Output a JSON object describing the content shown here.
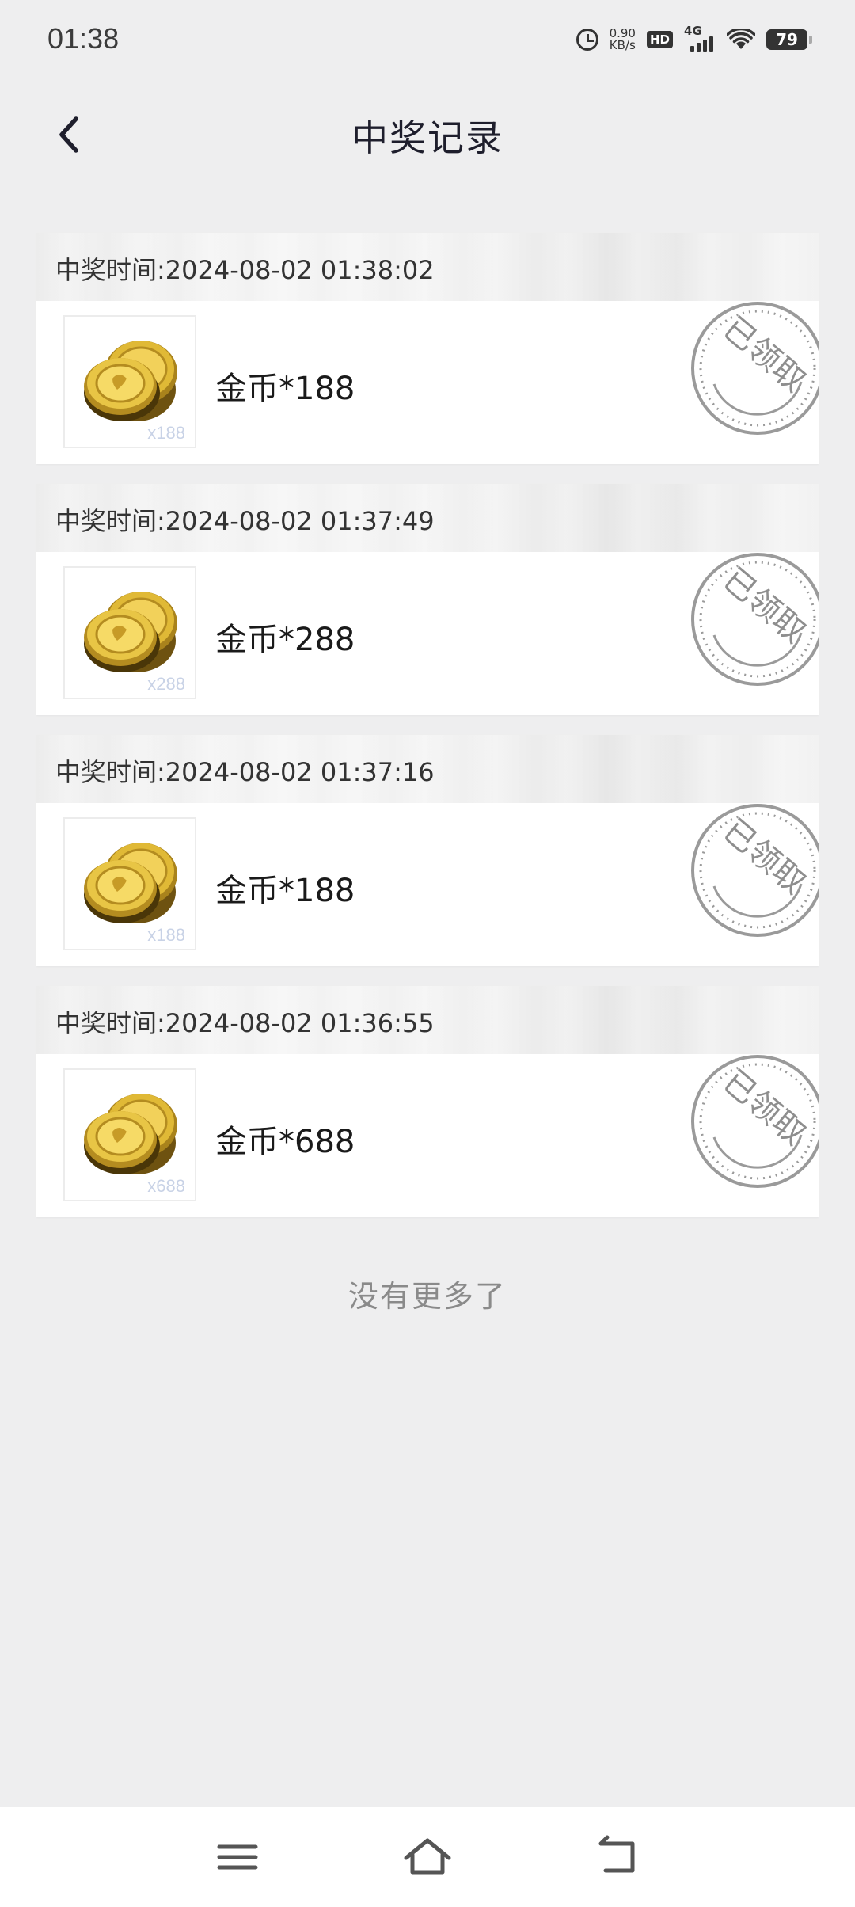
{
  "status_bar": {
    "time": "01:38",
    "net_speed_value": "0.90",
    "net_speed_unit": "KB/s",
    "hd_label": "HD",
    "network_label": "4G",
    "battery": "79"
  },
  "header": {
    "title": "中奖记录"
  },
  "records": [
    {
      "time_label": "中奖时间:2024-08-02 01:38:02",
      "reward": "金币*188",
      "qty": "x188",
      "stamp": "已领取"
    },
    {
      "time_label": "中奖时间:2024-08-02 01:37:49",
      "reward": "金币*288",
      "qty": "x288",
      "stamp": "已领取"
    },
    {
      "time_label": "中奖时间:2024-08-02 01:37:16",
      "reward": "金币*188",
      "qty": "x188",
      "stamp": "已领取"
    },
    {
      "time_label": "中奖时间:2024-08-02 01:36:55",
      "reward": "金币*688",
      "qty": "x688",
      "stamp": "已领取"
    }
  ],
  "footer": {
    "no_more": "没有更多了"
  },
  "nav": {
    "items": [
      "menu-icon",
      "home-icon",
      "back-icon"
    ]
  },
  "colors": {
    "background": "#eeeeef",
    "card": "#ffffff",
    "stamp": "#9a9a9a",
    "coin": "#d4a92e"
  }
}
